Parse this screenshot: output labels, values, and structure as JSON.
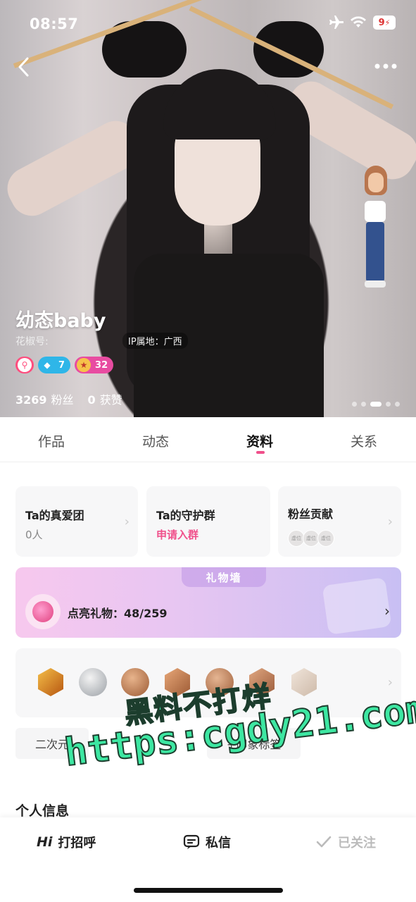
{
  "status_bar": {
    "time": "08:57",
    "battery": "9"
  },
  "profile": {
    "nickname": "幼态baby",
    "id_label": "花椒号:",
    "ip_location": "IP属地：广西",
    "badge_diamond": "7",
    "badge_star": "32",
    "fans_count": "3269",
    "fans_label": "粉丝",
    "likes_count": "0",
    "likes_label": "获赞"
  },
  "tabs": [
    {
      "label": "作品"
    },
    {
      "label": "动态"
    },
    {
      "label": "资料"
    },
    {
      "label": "关系"
    }
  ],
  "active_tab": "资料",
  "cards": {
    "true_love": {
      "title": "Ta的真爱团",
      "value": "0人"
    },
    "guard": {
      "title": "Ta的守护群",
      "action": "申请入群"
    },
    "fans_contrib": {
      "title": "粉丝贡献",
      "placeholder": "虚位"
    }
  },
  "gift_wall": {
    "title": "礼物墙",
    "label": "点亮礼物：48/259"
  },
  "medal_icons": [
    "number-7-medal-icon",
    "silver-medal-icon",
    "30k-medal-icon",
    "bronze-medal-icon",
    "heart-medal-icon",
    "bronze-badge-icon",
    "pale-badge-icon"
  ],
  "tags": [
    "二次元",
    "+印象标签"
  ],
  "section_title": "个人信息",
  "bottom_bar": {
    "greet": "打招呼",
    "greet_prefix": "Hi",
    "message": "私信",
    "followed": "已关注"
  },
  "watermark": {
    "line1": "黑料不打烊",
    "line2": "https:cgdy21.com"
  },
  "colors": {
    "accent_pink": "#f0508b",
    "watermark_green": "#3de7a2"
  }
}
